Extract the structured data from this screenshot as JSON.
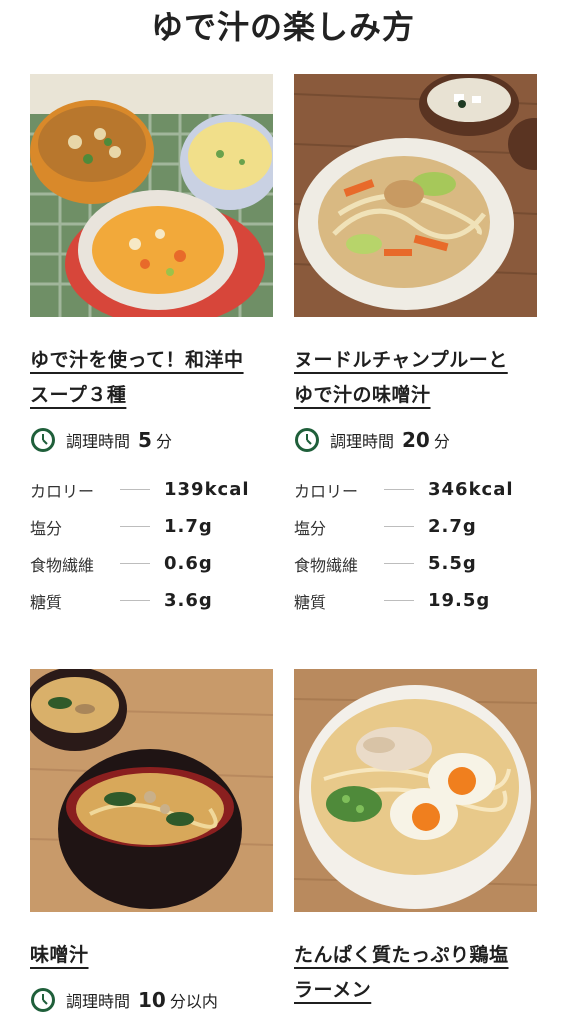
{
  "page": {
    "title": "ゆで汁の楽しみ方"
  },
  "recipes": [
    {
      "title_lines": [
        "ゆで汁を使って！和洋中",
        "スープ３種"
      ],
      "time_label": "調理時間",
      "time_value": "5",
      "time_unit": "分",
      "nutrition": [
        {
          "label": "カロリー",
          "value": "139kcal"
        },
        {
          "label": "塩分",
          "value": "1.7g"
        },
        {
          "label": "食物繊維",
          "value": "0.6g"
        },
        {
          "label": "糖質",
          "value": "3.6g"
        }
      ]
    },
    {
      "title_lines": [
        "ヌードルチャンプルーと",
        "ゆで汁の味噌汁"
      ],
      "time_label": "調理時間",
      "time_value": "20",
      "time_unit": "分",
      "nutrition": [
        {
          "label": "カロリー",
          "value": "346kcal"
        },
        {
          "label": "塩分",
          "value": "2.7g"
        },
        {
          "label": "食物繊維",
          "value": "5.5g"
        },
        {
          "label": "糖質",
          "value": "19.5g"
        }
      ]
    },
    {
      "title_lines": [
        "味噌汁"
      ],
      "time_label": "調理時間",
      "time_value": "10",
      "time_unit": "分以内"
    },
    {
      "title_lines": [
        "たんぱく質たっぷり鶏塩",
        "ラーメン"
      ]
    }
  ],
  "colors": {
    "clock_green": "#1f5f3a",
    "text": "#1f1f1f"
  }
}
